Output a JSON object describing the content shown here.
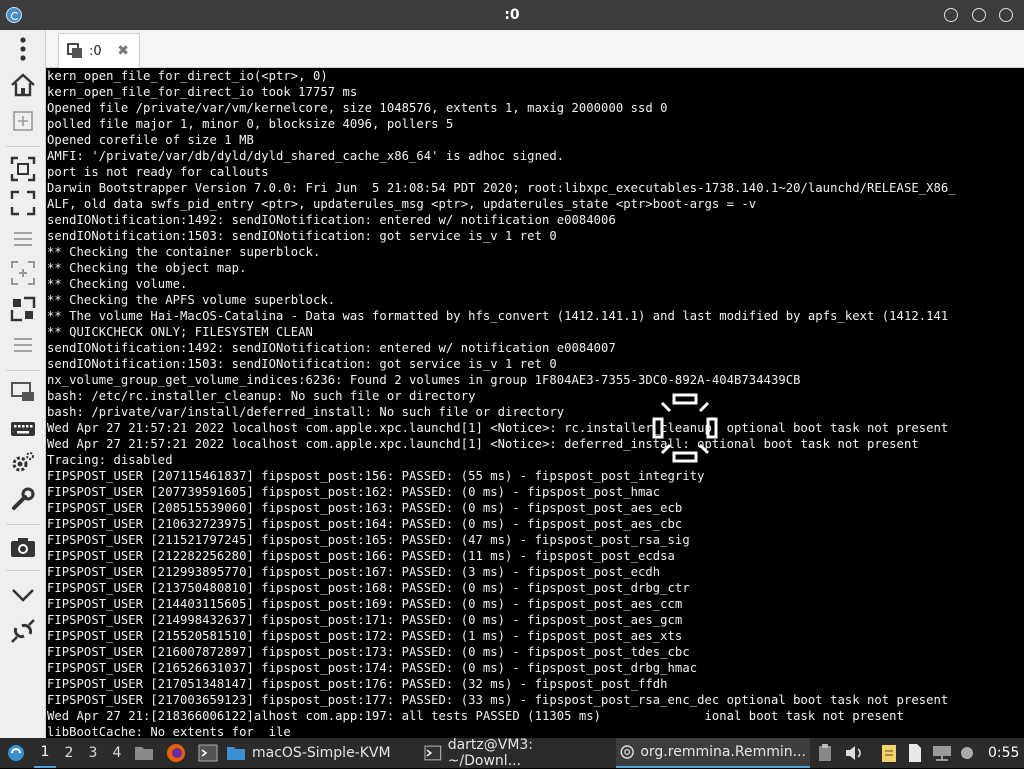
{
  "window": {
    "title": ":0"
  },
  "tab": {
    "label": ":0"
  },
  "terminal": {
    "lines": [
      "kern_open_file_for_direct_io(<ptr>, 0)",
      "kern_open_file_for_direct_io took 17757 ms",
      "Opened file /private/var/vm/kernelcore, size 1048576, extents 1, maxig 2000000 ssd 0",
      "polled file major 1, minor 0, blocksize 4096, pollers 5",
      "Opened corefile of size 1 MB",
      "AMFI: '/private/var/db/dyld/dyld_shared_cache_x86_64' is adhoc signed.",
      "port is not ready for callouts",
      "Darwin Bootstrapper Version 7.0.0: Fri Jun  5 21:08:54 PDT 2020; root:libxpc_executables-1738.140.1~20/launchd/RELEASE_X86_",
      "ALF, old data swfs_pid_entry <ptr>, updaterules_msg <ptr>, updaterules_state <ptr>boot-args = -v",
      "sendIONotification:1492: sendIONotification: entered w/ notification e0084006",
      "sendIONotification:1503: sendIONotification: got service is_v 1 ret 0",
      "** Checking the container superblock.",
      "** Checking the object map.",
      "** Checking volume.",
      "** Checking the APFS volume superblock.",
      "** The volume Hai-MacOS-Catalina - Data was formatted by hfs_convert (1412.141.1) and last modified by apfs_kext (1412.141",
      "** QUICKCHECK ONLY; FILESYSTEM CLEAN",
      "sendIONotification:1492: sendIONotification: entered w/ notification e0084007",
      "sendIONotification:1503: sendIONotification: got service is_v 1 ret 0",
      "nx_volume_group_get_volume_indices:6236: Found 2 volumes in group 1F804AE3-7355-3DC0-892A-404B734439CB",
      "bash: /etc/rc.installer_cleanup: No such file or directory",
      "bash: /private/var/install/deferred_install: No such file or directory",
      "Wed Apr 27 21:57:21 2022 localhost com.apple.xpc.launchd[1] <Notice>: rc.installer_cleanup: optional boot task not present",
      "Wed Apr 27 21:57:21 2022 localhost com.apple.xpc.launchd[1] <Notice>: deferred_install: optional boot task not present",
      "Tracing: disabled",
      "FIPSPOST_USER [207115461837] fipspost_post:156: PASSED: (55 ms) - fipspost_post_integrity",
      "FIPSPOST_USER [207739591605] fipspost_post:162: PASSED: (0 ms) - fipspost_post_hmac",
      "FIPSPOST_USER [208515539060] fipspost_post:163: PASSED: (0 ms) - fipspost_post_aes_ecb",
      "FIPSPOST_USER [210632723975] fipspost_post:164: PASSED: (0 ms) - fipspost_post_aes_cbc",
      "FIPSPOST_USER [211521797245] fipspost_post:165: PASSED: (47 ms) - fipspost_post_rsa_sig",
      "FIPSPOST_USER [212282256280] fipspost_post:166: PASSED: (11 ms) - fipspost_post_ecdsa",
      "FIPSPOST_USER [212993895770] fipspost_post:167: PASSED: (3 ms) - fipspost_post_ecdh",
      "FIPSPOST_USER [213750480810] fipspost_post:168: PASSED: (0 ms) - fipspost_post_drbg_ctr",
      "FIPSPOST_USER [214403115605] fipspost_post:169: PASSED: (0 ms) - fipspost_post_aes_ccm",
      "FIPSPOST_USER [214998432637] fipspost_post:171: PASSED: (0 ms) - fipspost_post_aes_gcm",
      "FIPSPOST_USER [215520581510] fipspost_post:172: PASSED: (1 ms) - fipspost_post_aes_xts",
      "FIPSPOST_USER [216007872897] fipspost_post:173: PASSED: (0 ms) - fipspost_post_tdes_cbc",
      "FIPSPOST_USER [216526631037] fipspost_post:174: PASSED: (0 ms) - fipspost_post_drbg_hmac",
      "FIPSPOST_USER [217051348147] fipspost_post:176: PASSED: (32 ms) - fipspost_post_ffdh",
      "FIPSPOST_USER [217003659123] fipspost_post:177: PASSED: (33 ms) - fipspost_post_rsa_enc_dec optional boot task not present",
      "Wed Apr 27 21:[218366006122]alhost com.app:197: all tests PASSED (11305 ms)              ional boot task not present",
      "libBootCache: No extents for  ile"
    ]
  },
  "sidebar": {
    "items": [
      {
        "name": "menu-dots-icon"
      },
      {
        "name": "home-icon"
      },
      {
        "name": "add-tab-icon"
      },
      {
        "name": "fit-window-icon"
      },
      {
        "name": "fullscreen-icon"
      },
      {
        "name": "toolbar-menu-icon"
      },
      {
        "name": "scale-icon"
      },
      {
        "name": "fit-screen-icon"
      },
      {
        "name": "toolbar-menu-icon"
      },
      {
        "name": "multi-monitor-icon"
      },
      {
        "name": "keyboard-icon"
      },
      {
        "name": "preferences-icon"
      },
      {
        "name": "tools-icon"
      },
      {
        "name": "screenshot-icon"
      },
      {
        "name": "chevron-down-icon"
      },
      {
        "name": "disconnect-icon"
      }
    ]
  },
  "taskbar": {
    "workspaces": [
      "1",
      "2",
      "3",
      "4"
    ],
    "tasks": [
      {
        "label": "macOS-Simple-KVM"
      },
      {
        "label": "dartz@VM3: ~/Downl..."
      },
      {
        "label": "org.remmina.Remmin..."
      }
    ],
    "clock": "0:55"
  },
  "colors": {
    "accent": "#4aa3df",
    "terminal_bg": "#000000",
    "terminal_fg": "#f2f2f2"
  }
}
